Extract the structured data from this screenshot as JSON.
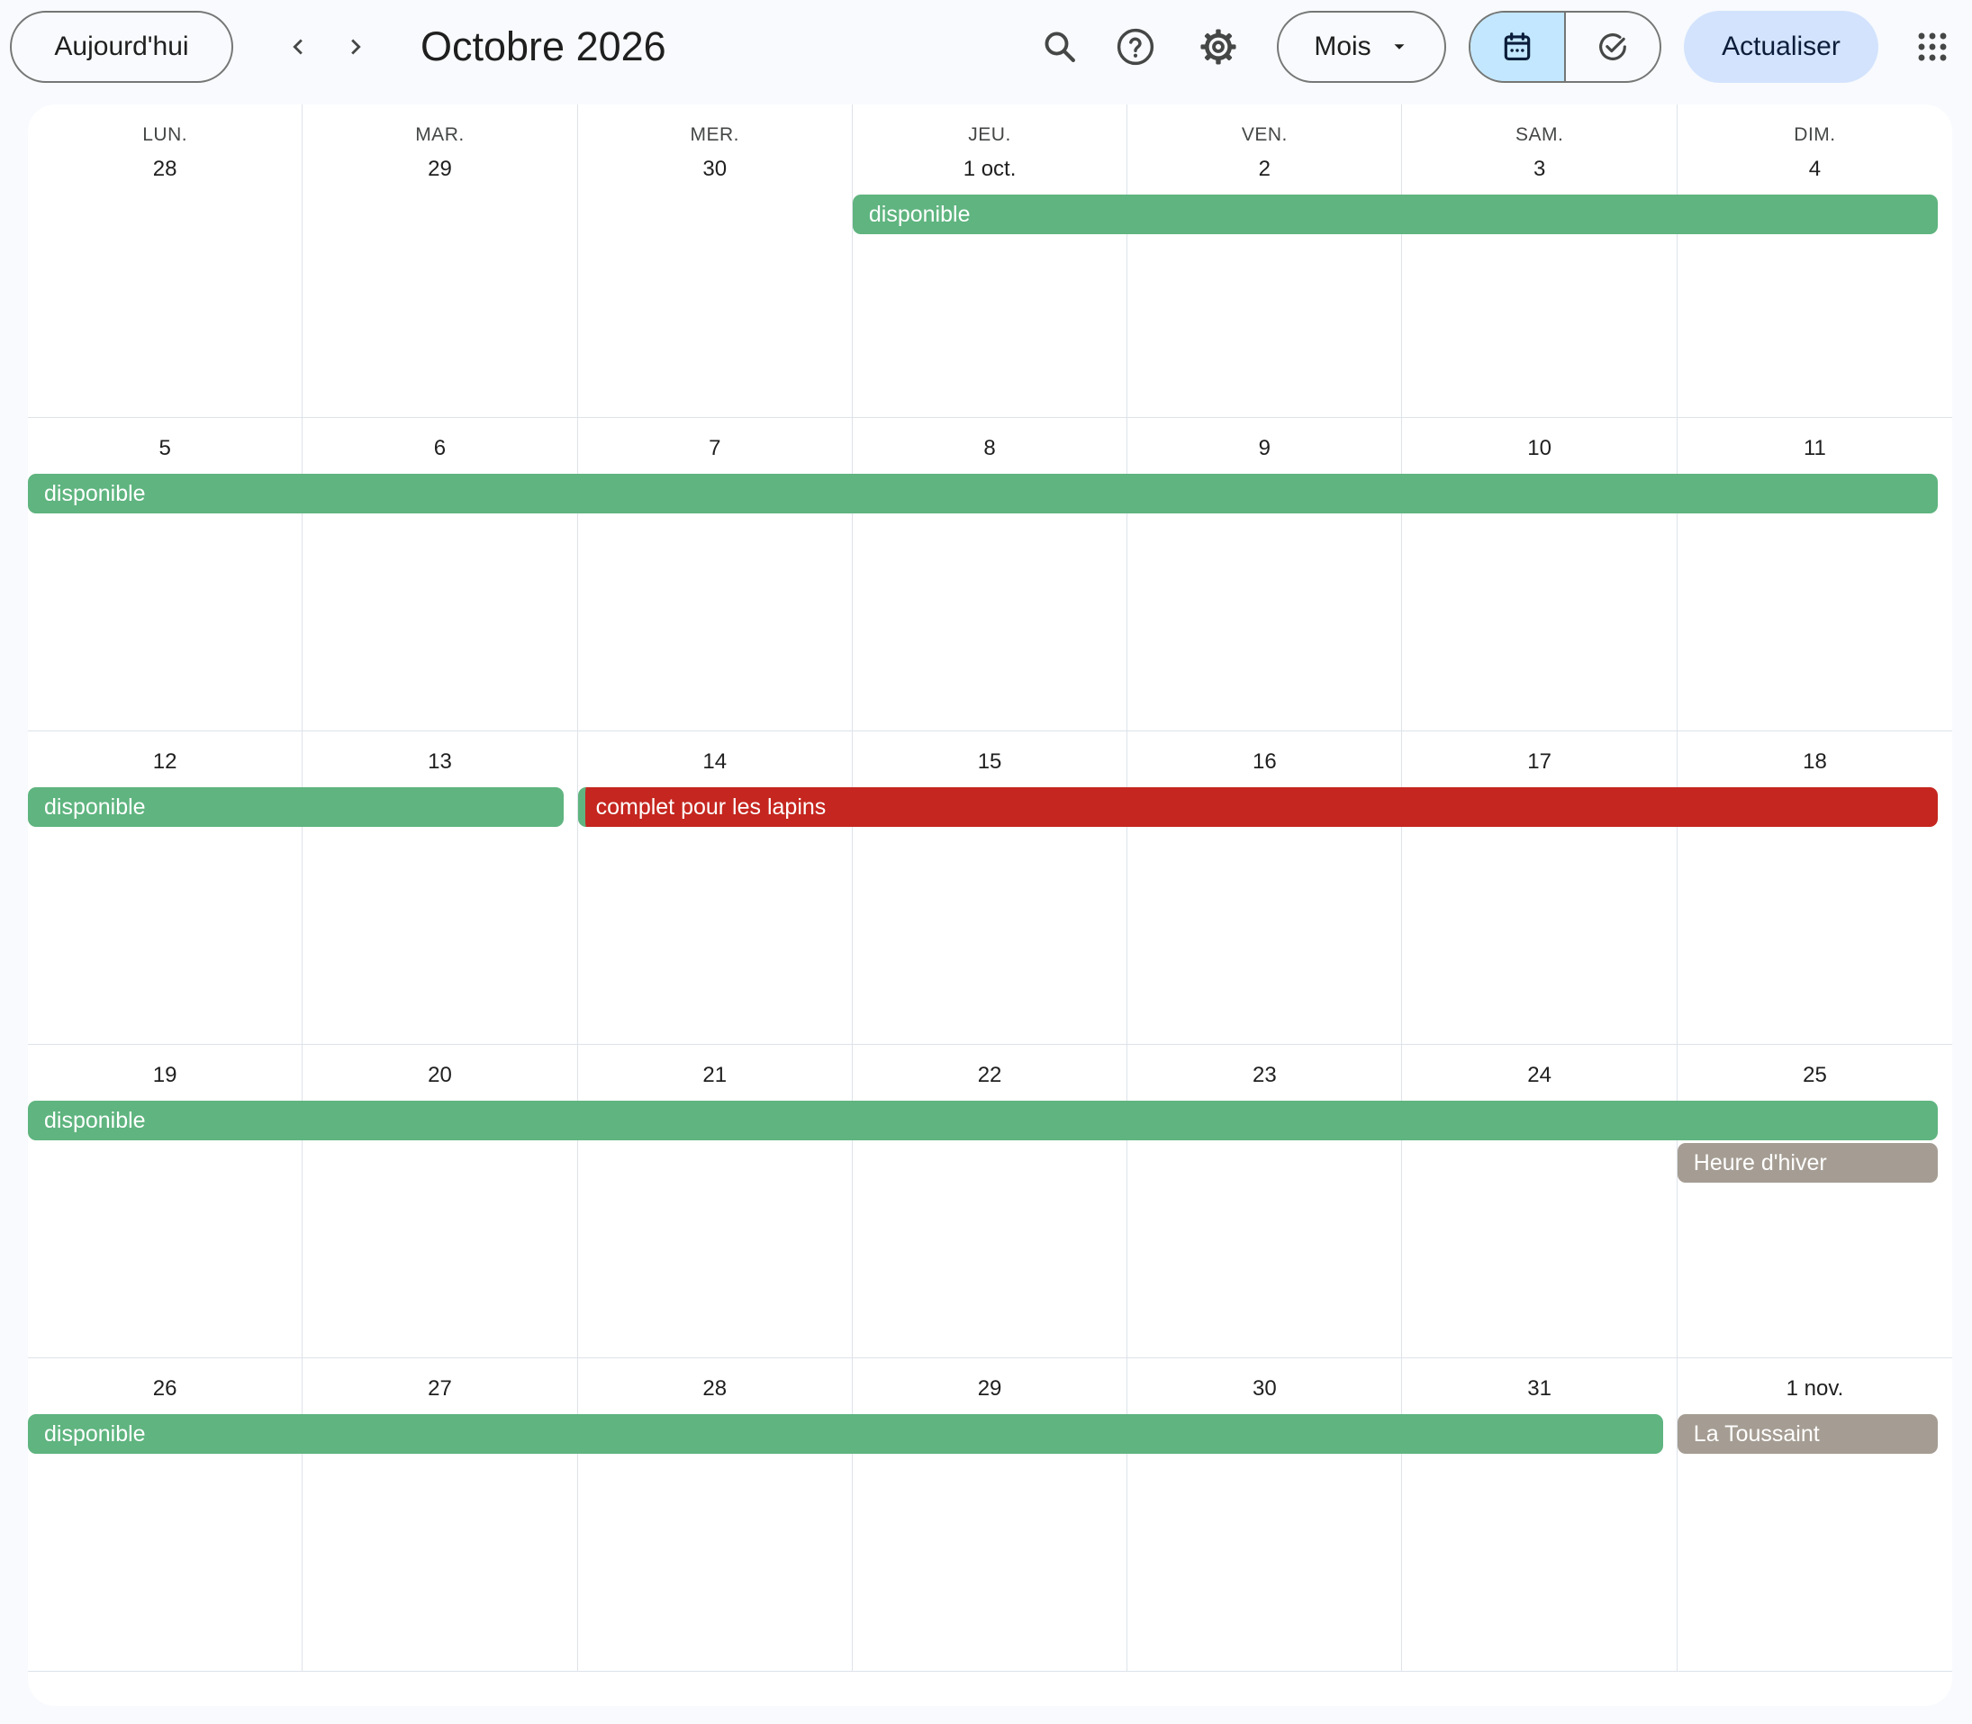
{
  "toolbar": {
    "today_label": "Aujourd'hui",
    "title": "Octobre 2026",
    "view_label": "Mois",
    "refresh_label": "Actualiser",
    "icons": [
      "chevron-left-icon",
      "chevron-right-icon",
      "search-icon",
      "help-icon",
      "gear-icon",
      "dropdown-arrow-icon",
      "calendar-icon",
      "tasks-check-icon",
      "apps-grid-icon"
    ]
  },
  "weekdays": [
    "LUN.",
    "MAR.",
    "MER.",
    "JEU.",
    "VEN.",
    "SAM.",
    "DIM."
  ],
  "weeks": [
    {
      "dates": [
        "28",
        "29",
        "30",
        "1 oct.",
        "2",
        "3",
        "4"
      ],
      "events": [
        {
          "title": "disponible",
          "start": 3,
          "span": 4,
          "lane": 0,
          "style": "green"
        }
      ]
    },
    {
      "dates": [
        "5",
        "6",
        "7",
        "8",
        "9",
        "10",
        "11"
      ],
      "events": [
        {
          "title": "disponible",
          "start": 0,
          "span": 7,
          "lane": 0,
          "style": "green"
        }
      ]
    },
    {
      "dates": [
        "12",
        "13",
        "14",
        "15",
        "16",
        "17",
        "18"
      ],
      "events": [
        {
          "title": "disponible",
          "start": 0,
          "span": 2,
          "lane": 0,
          "style": "green"
        },
        {
          "title": "complet pour les lapins",
          "start": 2,
          "span": 5,
          "lane": 0,
          "style": "red"
        }
      ]
    },
    {
      "dates": [
        "19",
        "20",
        "21",
        "22",
        "23",
        "24",
        "25"
      ],
      "events": [
        {
          "title": "disponible",
          "start": 0,
          "span": 7,
          "lane": 0,
          "style": "green"
        },
        {
          "title": "Heure d'hiver",
          "start": 6,
          "span": 1,
          "lane": 1,
          "style": "grey"
        }
      ]
    },
    {
      "dates": [
        "26",
        "27",
        "28",
        "29",
        "30",
        "31",
        "1 nov."
      ],
      "events": [
        {
          "title": "disponible",
          "start": 0,
          "span": 6,
          "lane": 0,
          "style": "green"
        },
        {
          "title": "La Toussaint",
          "start": 6,
          "span": 1,
          "lane": 0,
          "style": "grey"
        }
      ]
    }
  ],
  "colors": {
    "available": "#5fb47f",
    "full": "#c5261f",
    "holiday": "#a59d93",
    "active_view": "#c2e7ff",
    "refresh_bg": "#d3e3fd"
  }
}
